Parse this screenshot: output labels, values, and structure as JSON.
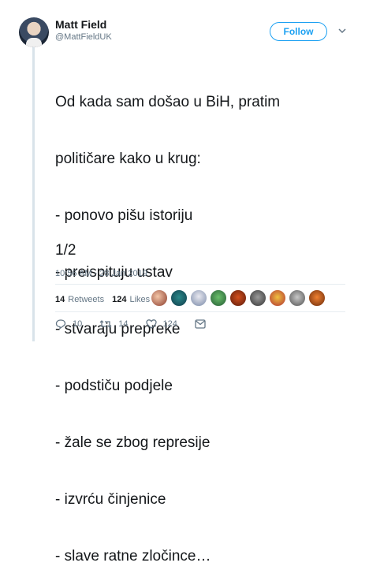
{
  "user": {
    "name": "Matt Field",
    "handle": "@MattFieldUK"
  },
  "follow_label": "Follow",
  "tweet": {
    "lines": [
      "Od kada sam došao u BiH, pratim",
      "političare kako u krug:",
      "- ponovo pišu istoriju",
      "- preispituju ustav",
      "- stvaraju prepreke",
      "- podstiču podjele",
      "- žale se zbog represije",
      "- izvrću činjenice",
      "- slave ratne zločince…"
    ],
    "counter": "1/2",
    "timestamp": "10:56 AM - 28 Jan 2019"
  },
  "stats": {
    "retweets_count": "14",
    "retweets_label": "Retweets",
    "likes_count": "124",
    "likes_label": "Likes"
  },
  "actions": {
    "replies": "10",
    "retweets": "14",
    "likes": "124"
  },
  "colors": {
    "accent": "#1da1f2",
    "muted": "#657786",
    "text": "#14171a",
    "divider": "#e6ecf0"
  }
}
